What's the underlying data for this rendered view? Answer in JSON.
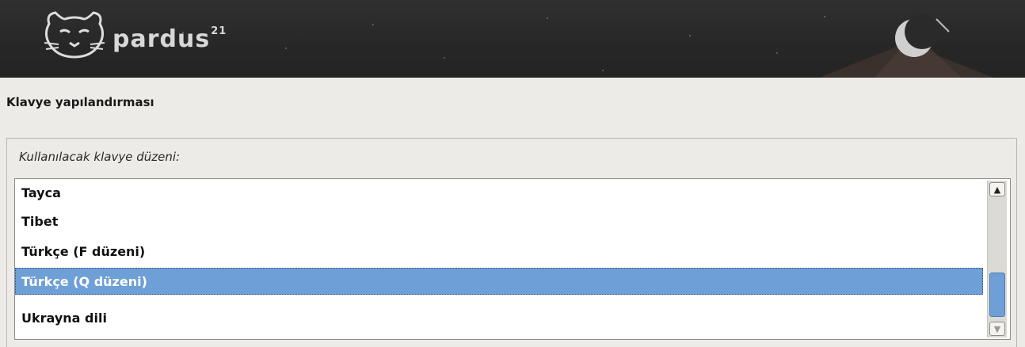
{
  "banner": {
    "logo_text": "pardus",
    "logo_superscript": "21",
    "icons": [
      "cat-logo-icon",
      "moon-mountain-icon"
    ]
  },
  "page": {
    "title": "Klavye yapılandırması",
    "prompt": "Kullanılacak klavye düzeni:"
  },
  "keyboard_list": {
    "items": [
      {
        "label": "Tayca"
      },
      {
        "label": "Tibet"
      },
      {
        "label": "Türkçe (F düzeni)"
      },
      {
        "label": "Türkçe (Q düzeni)",
        "selected": true
      },
      {
        "label": "Ukrayna dili"
      }
    ],
    "scroll_position_fraction": 0.7,
    "selection_color": "#6e9fd6"
  },
  "scrollbar": {
    "up_icon": "chevron-up-icon",
    "down_icon": "chevron-down-icon"
  }
}
